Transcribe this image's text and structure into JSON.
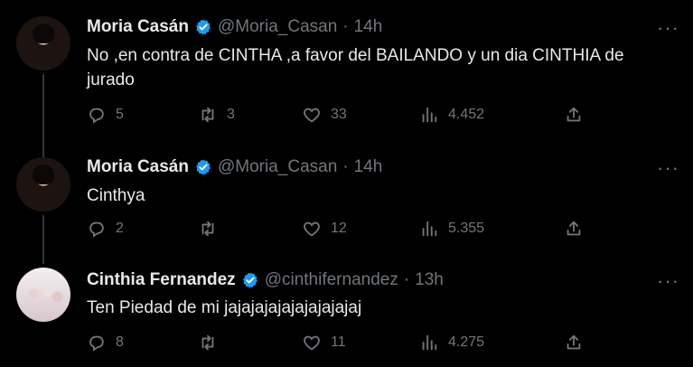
{
  "tweets": [
    {
      "name": "Moria Casán",
      "handle": "@Moria_Casan",
      "time": "14h",
      "text": "No ,en contra de CINTHA ,a favor del BAILANDO y un dia CINTHIA de jurado",
      "replies": "5",
      "retweets": "3",
      "likes": "33",
      "views": "4.452"
    },
    {
      "name": "Moria Casán",
      "handle": "@Moria_Casan",
      "time": "14h",
      "text": "Cinthya",
      "replies": "2",
      "retweets": "",
      "likes": "12",
      "views": "5.355"
    },
    {
      "name": "Cinthia Fernandez",
      "handle": "@cinthifernandez",
      "time": "13h",
      "text": "Ten Piedad de mi jajajajajajajajajajaj",
      "replies": "8",
      "retweets": "",
      "likes": "11",
      "views": "4.275"
    }
  ],
  "ui": {
    "dot": "·",
    "more": "···"
  },
  "colors": {
    "background": "#000000",
    "text": "#e7e9ea",
    "muted": "#71767b",
    "verified": "#1d9bf0",
    "thread_line": "#333639"
  }
}
